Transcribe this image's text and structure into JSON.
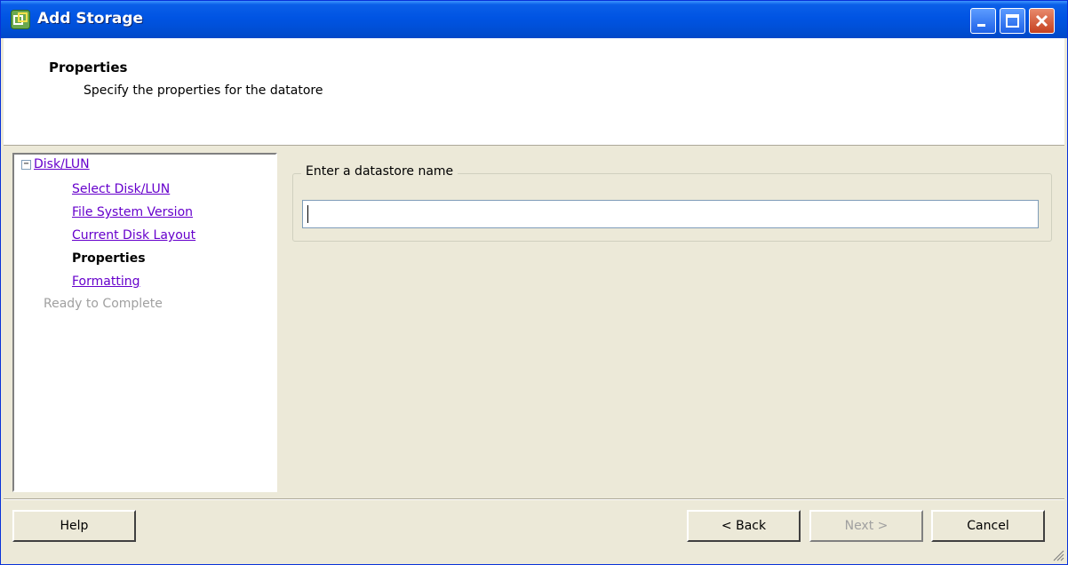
{
  "window": {
    "title": "Add Storage"
  },
  "header": {
    "title": "Properties",
    "subtitle": "Specify the properties for the datatore"
  },
  "nav": {
    "toggle_symbol": "−",
    "items": [
      {
        "label": "Disk/LUN",
        "state": "link"
      },
      {
        "label": "Select Disk/LUN",
        "state": "link"
      },
      {
        "label": "File System Version",
        "state": "link"
      },
      {
        "label": "Current Disk Layout",
        "state": "link"
      },
      {
        "label": "Properties",
        "state": "current"
      },
      {
        "label": "Formatting",
        "state": "link"
      },
      {
        "label": "Ready to Complete",
        "state": "disabled"
      }
    ]
  },
  "form": {
    "group_label": "Enter a datastore name",
    "datastore_name": ""
  },
  "buttons": {
    "help": "Help",
    "back": "< Back",
    "next": "Next >",
    "cancel": "Cancel"
  },
  "colors": {
    "title_bar": "#0054e3",
    "link": "#6600cc",
    "disabled_text": "#a0a0a0",
    "dialog_bg": "#ece9d8"
  }
}
